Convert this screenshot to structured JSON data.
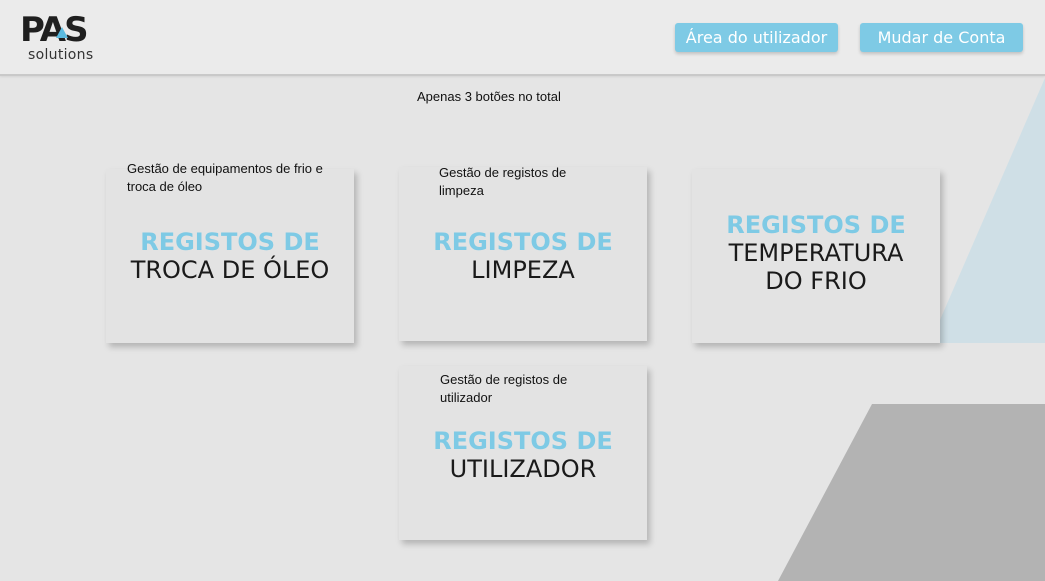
{
  "header": {
    "logo_text": "PAS",
    "logo_sub": "solutions",
    "buttons": {
      "user_area": "Área do utilizador",
      "switch_account": "Mudar de Conta"
    }
  },
  "note": "Apenas 3 botões no total",
  "cards": [
    {
      "description": "Gestão de equipamentos de frio e troca de óleo",
      "highlight": "REGISTOS DE",
      "title": "TROCA DE ÓLEO"
    },
    {
      "description": "Gestão de registos de limpeza",
      "highlight": "REGISTOS DE",
      "title": "LIMPEZA"
    },
    {
      "description": "",
      "highlight": "REGISTOS DE",
      "title_line1": "TEMPERATURA",
      "title_line2": "DO FRIO"
    },
    {
      "description": "Gestão de registos de utilizador",
      "highlight": "REGISTOS DE",
      "title": "UTILIZADOR"
    }
  ],
  "colors": {
    "accent": "#7ecae5",
    "background": "#e5e5e5",
    "decor_light_blue": "#cfdfe6",
    "decor_gray": "#b3b3b3"
  }
}
